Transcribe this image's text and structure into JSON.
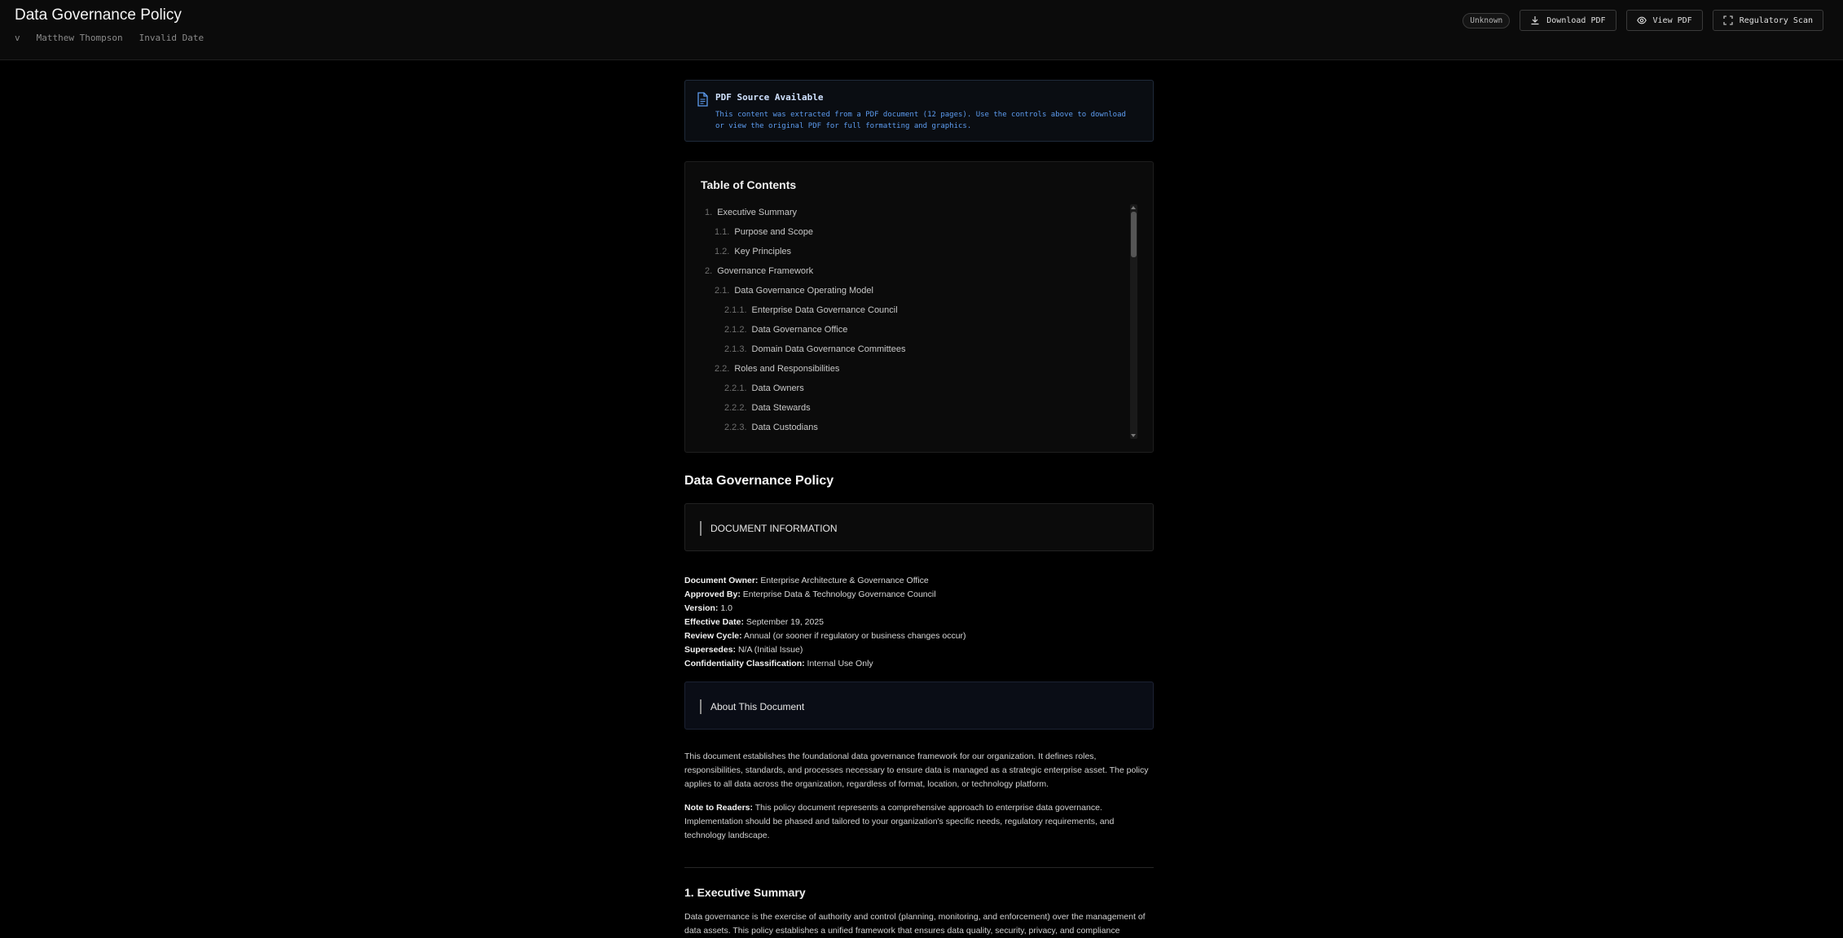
{
  "header": {
    "title": "Data Governance Policy",
    "version_prefix": "v",
    "author": "Matthew Thompson",
    "date": "Invalid Date",
    "status_badge": "Unknown",
    "download_label": "Download PDF",
    "view_label": "View PDF",
    "scan_label": "Regulatory Scan"
  },
  "notice": {
    "title": "PDF Source Available",
    "text": "This content was extracted from a PDF document (12 pages). Use the controls above to download or view the original PDF for full formatting and graphics."
  },
  "toc": {
    "title": "Table of Contents",
    "items": [
      {
        "num": "1.",
        "label": "Executive Summary"
      },
      {
        "num": "1.1.",
        "label": "Purpose and Scope"
      },
      {
        "num": "1.2.",
        "label": "Key Principles"
      },
      {
        "num": "2.",
        "label": "Governance Framework"
      },
      {
        "num": "2.1.",
        "label": "Data Governance Operating Model"
      },
      {
        "num": "2.1.1.",
        "label": "Enterprise Data Governance Council"
      },
      {
        "num": "2.1.2.",
        "label": "Data Governance Office"
      },
      {
        "num": "2.1.3.",
        "label": "Domain Data Governance Committees"
      },
      {
        "num": "2.2.",
        "label": "Roles and Responsibilities"
      },
      {
        "num": "2.2.1.",
        "label": "Data Owners"
      },
      {
        "num": "2.2.2.",
        "label": "Data Stewards"
      },
      {
        "num": "2.2.3.",
        "label": "Data Custodians"
      }
    ]
  },
  "document": {
    "heading": "Data Governance Policy",
    "info_callout": "DOCUMENT INFORMATION",
    "info": [
      {
        "key": "Document Owner:",
        "value": "Enterprise Architecture & Governance Office"
      },
      {
        "key": "Approved By:",
        "value": "Enterprise Data & Technology Governance Council"
      },
      {
        "key": "Version:",
        "value": "1.0"
      },
      {
        "key": "Effective Date:",
        "value": "September 19, 2025"
      },
      {
        "key": "Review Cycle:",
        "value": "Annual (or sooner if regulatory or business changes occur)"
      },
      {
        "key": "Supersedes:",
        "value": "N/A (Initial Issue)"
      },
      {
        "key": "Confidentiality Classification:",
        "value": "Internal Use Only"
      }
    ],
    "about_callout": "About This Document",
    "about_text": "This document establishes the foundational data governance framework for our organization. It defines roles, responsibilities, standards, and processes necessary to ensure data is managed as a strategic enterprise asset. The policy applies to all data across the organization, regardless of format, location, or technology platform.",
    "note_key": "Note to Readers:",
    "note_text": "This policy document represents a comprehensive approach to enterprise data governance. Implementation should be phased and tailored to your organization's specific needs, regulatory requirements, and technology landscape.",
    "section1_title": "1. Executive Summary",
    "section1_text": "Data governance is the exercise of authority and control (planning, monitoring, and enforcement) over the management of data assets. This policy establishes a unified framework that ensures data quality, security, privacy, and compliance"
  }
}
